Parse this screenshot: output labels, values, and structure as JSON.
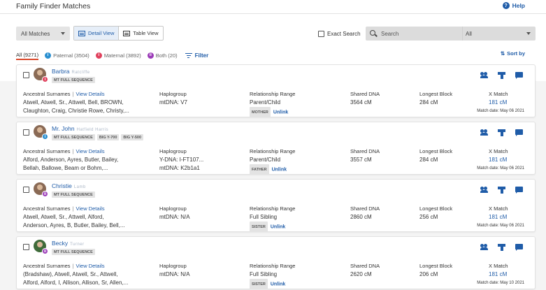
{
  "header": {
    "title": "Family Finder Matches",
    "help_label": "Help"
  },
  "toolbar": {
    "match_filter": "All Matches",
    "detail_view": "Detail View",
    "table_view": "Table View",
    "exact_search": "Exact Search",
    "search_placeholder": "Search",
    "search_scope": "All",
    "sort_by": "Sort by",
    "filter": "Filter"
  },
  "tabs": [
    {
      "label": "All (9271)",
      "icon": "",
      "color": ""
    },
    {
      "label": "Paternal (3504)",
      "icon": "paternal-icon",
      "color": "#2a8fd0"
    },
    {
      "label": "Maternal (3892)",
      "icon": "maternal-icon",
      "color": "#e0415d"
    },
    {
      "label": "Both (20)",
      "icon": "both-icon",
      "color": "#9b3bb8"
    }
  ],
  "columns": {
    "surnames": "Ancestral Surnames",
    "view_details": "View Details",
    "haplogroup": "Haplogroup",
    "relationship": "Relationship Range",
    "shared_dna": "Shared DNA",
    "longest_block": "Longest Block",
    "x_match": "X Match",
    "unlink": "Unlink"
  },
  "matches": [
    {
      "name": "Barbra",
      "name_blur": "Ratcliffe",
      "badge_color": "#e0415d",
      "tags": [
        "MT FULL SEQUENCE"
      ],
      "surnames_line1": "Atwell, Atwell, Sr., Attwell, Bell, BROWN,",
      "surnames_line2": "Claughton, Craig, Christie Rowe, Christy,...",
      "hap_line1": "mtDNA: V7",
      "hap_line2": "",
      "relationship": "Parent/Child",
      "rel_tag": "MOTHER",
      "shared_dna": "3564 cM",
      "longest_block": "284 cM",
      "x_match": "181 cM",
      "match_date": "Match date: May 06 2021"
    },
    {
      "name": "Mr. John",
      "name_blur": "Hatfield Harris",
      "badge_color": "#2a8fd0",
      "tags": [
        "MT FULL SEQUENCE",
        "BIG Y-700",
        "BIG Y-500"
      ],
      "surnames_line1": "Alford, Anderson, Ayres, Butler, Bailey,",
      "surnames_line2": "Bellah, Ballowe, Beam or Bohm,...",
      "hap_line1": "Y-DNA: I-FT107...",
      "hap_line2": "mtDNA: K2b1a1",
      "relationship": "Parent/Child",
      "rel_tag": "FATHER",
      "shared_dna": "3557 cM",
      "longest_block": "284 cM",
      "x_match": "181 cM",
      "match_date": "Match date: May 06 2021"
    },
    {
      "name": "Christie",
      "name_blur": "Lamb",
      "badge_color": "#9b3bb8",
      "tags": [
        "MT FULL SEQUENCE"
      ],
      "surnames_line1": "Atwell, Atwell, Sr., Attwell, Alford,",
      "surnames_line2": "Anderson, Ayres, B, Butler, Bailey, Bell,...",
      "hap_line1": "mtDNA: N/A",
      "hap_line2": "",
      "relationship": "Full Sibling",
      "rel_tag": "SISTER",
      "shared_dna": "2860 cM",
      "longest_block": "256 cM",
      "x_match": "181 cM",
      "match_date": "Match date: May 06 2021"
    },
    {
      "name": "Becky",
      "name_blur": "Turner",
      "badge_color": "#9b3bb8",
      "tags": [
        "MT FULL SEQUENCE"
      ],
      "surnames_line1": "(Bradshaw), Atwell, Atwell, Sr., Attwell,",
      "surnames_line2": "Alford, Alford, I, Allison, Allison, Sr, Allen,...",
      "hap_line1": "mtDNA: N/A",
      "hap_line2": "",
      "relationship": "Full Sibling",
      "rel_tag": "SISTER",
      "shared_dna": "2620 cM",
      "longest_block": "206 cM",
      "x_match": "181 cM",
      "match_date": "Match date: May 10 2021"
    }
  ]
}
